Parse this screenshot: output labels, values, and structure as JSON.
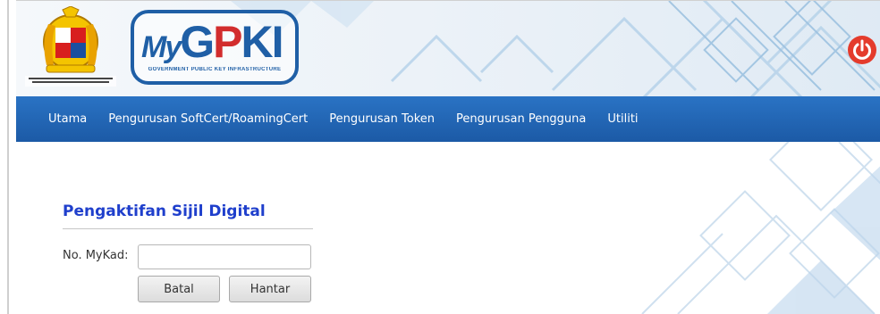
{
  "header": {
    "crest_icon": "malaysia-coat-of-arms-icon",
    "logo_text_my": "My",
    "logo_text_g": "G",
    "logo_text_p": "P",
    "logo_text_ki": "KI",
    "logo_subtitle": "GOVERNMENT PUBLIC KEY INFRASTRUCTURE",
    "power_icon": "power-icon",
    "accent": "#e43b2c"
  },
  "nav": {
    "items": [
      {
        "label": "Utama"
      },
      {
        "label": "Pengurusan SoftCert/RoamingCert"
      },
      {
        "label": "Pengurusan Token"
      },
      {
        "label": "Pengurusan Pengguna"
      },
      {
        "label": "Utiliti"
      }
    ],
    "color": "#1f63b3"
  },
  "form": {
    "title": "Pengaktifan Sijil Digital",
    "mykad_label": "No. MyKad:",
    "mykad_value": "",
    "cancel_label": "Batal",
    "submit_label": "Hantar",
    "title_color": "#1f3fcc"
  }
}
